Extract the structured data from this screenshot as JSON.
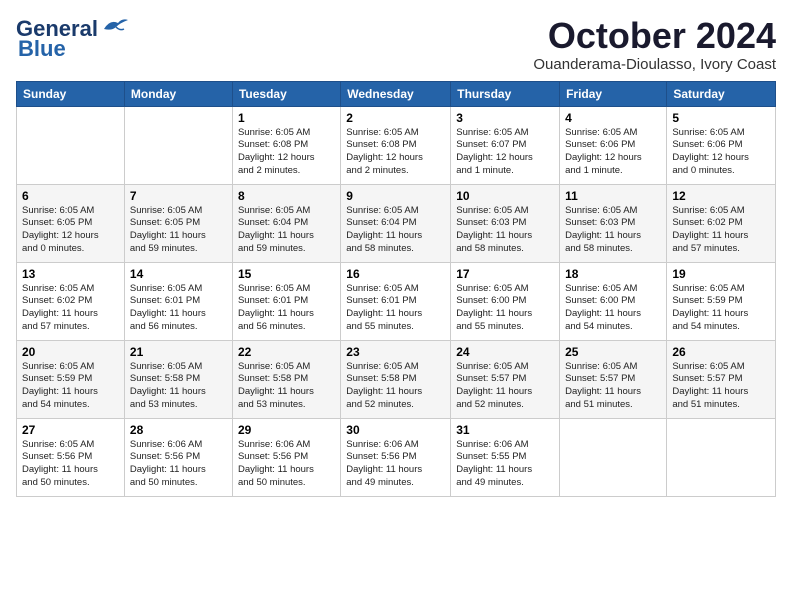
{
  "header": {
    "logo_line1": "General",
    "logo_line2": "Blue",
    "month_title": "October 2024",
    "location": "Ouanderama-Dioulasso, Ivory Coast"
  },
  "days_of_week": [
    "Sunday",
    "Monday",
    "Tuesday",
    "Wednesday",
    "Thursday",
    "Friday",
    "Saturday"
  ],
  "weeks": [
    [
      {
        "day": "",
        "info": ""
      },
      {
        "day": "",
        "info": ""
      },
      {
        "day": "1",
        "info": "Sunrise: 6:05 AM\nSunset: 6:08 PM\nDaylight: 12 hours\nand 2 minutes."
      },
      {
        "day": "2",
        "info": "Sunrise: 6:05 AM\nSunset: 6:08 PM\nDaylight: 12 hours\nand 2 minutes."
      },
      {
        "day": "3",
        "info": "Sunrise: 6:05 AM\nSunset: 6:07 PM\nDaylight: 12 hours\nand 1 minute."
      },
      {
        "day": "4",
        "info": "Sunrise: 6:05 AM\nSunset: 6:06 PM\nDaylight: 12 hours\nand 1 minute."
      },
      {
        "day": "5",
        "info": "Sunrise: 6:05 AM\nSunset: 6:06 PM\nDaylight: 12 hours\nand 0 minutes."
      }
    ],
    [
      {
        "day": "6",
        "info": "Sunrise: 6:05 AM\nSunset: 6:05 PM\nDaylight: 12 hours\nand 0 minutes."
      },
      {
        "day": "7",
        "info": "Sunrise: 6:05 AM\nSunset: 6:05 PM\nDaylight: 11 hours\nand 59 minutes."
      },
      {
        "day": "8",
        "info": "Sunrise: 6:05 AM\nSunset: 6:04 PM\nDaylight: 11 hours\nand 59 minutes."
      },
      {
        "day": "9",
        "info": "Sunrise: 6:05 AM\nSunset: 6:04 PM\nDaylight: 11 hours\nand 58 minutes."
      },
      {
        "day": "10",
        "info": "Sunrise: 6:05 AM\nSunset: 6:03 PM\nDaylight: 11 hours\nand 58 minutes."
      },
      {
        "day": "11",
        "info": "Sunrise: 6:05 AM\nSunset: 6:03 PM\nDaylight: 11 hours\nand 58 minutes."
      },
      {
        "day": "12",
        "info": "Sunrise: 6:05 AM\nSunset: 6:02 PM\nDaylight: 11 hours\nand 57 minutes."
      }
    ],
    [
      {
        "day": "13",
        "info": "Sunrise: 6:05 AM\nSunset: 6:02 PM\nDaylight: 11 hours\nand 57 minutes."
      },
      {
        "day": "14",
        "info": "Sunrise: 6:05 AM\nSunset: 6:01 PM\nDaylight: 11 hours\nand 56 minutes."
      },
      {
        "day": "15",
        "info": "Sunrise: 6:05 AM\nSunset: 6:01 PM\nDaylight: 11 hours\nand 56 minutes."
      },
      {
        "day": "16",
        "info": "Sunrise: 6:05 AM\nSunset: 6:01 PM\nDaylight: 11 hours\nand 55 minutes."
      },
      {
        "day": "17",
        "info": "Sunrise: 6:05 AM\nSunset: 6:00 PM\nDaylight: 11 hours\nand 55 minutes."
      },
      {
        "day": "18",
        "info": "Sunrise: 6:05 AM\nSunset: 6:00 PM\nDaylight: 11 hours\nand 54 minutes."
      },
      {
        "day": "19",
        "info": "Sunrise: 6:05 AM\nSunset: 5:59 PM\nDaylight: 11 hours\nand 54 minutes."
      }
    ],
    [
      {
        "day": "20",
        "info": "Sunrise: 6:05 AM\nSunset: 5:59 PM\nDaylight: 11 hours\nand 54 minutes."
      },
      {
        "day": "21",
        "info": "Sunrise: 6:05 AM\nSunset: 5:58 PM\nDaylight: 11 hours\nand 53 minutes."
      },
      {
        "day": "22",
        "info": "Sunrise: 6:05 AM\nSunset: 5:58 PM\nDaylight: 11 hours\nand 53 minutes."
      },
      {
        "day": "23",
        "info": "Sunrise: 6:05 AM\nSunset: 5:58 PM\nDaylight: 11 hours\nand 52 minutes."
      },
      {
        "day": "24",
        "info": "Sunrise: 6:05 AM\nSunset: 5:57 PM\nDaylight: 11 hours\nand 52 minutes."
      },
      {
        "day": "25",
        "info": "Sunrise: 6:05 AM\nSunset: 5:57 PM\nDaylight: 11 hours\nand 51 minutes."
      },
      {
        "day": "26",
        "info": "Sunrise: 6:05 AM\nSunset: 5:57 PM\nDaylight: 11 hours\nand 51 minutes."
      }
    ],
    [
      {
        "day": "27",
        "info": "Sunrise: 6:05 AM\nSunset: 5:56 PM\nDaylight: 11 hours\nand 50 minutes."
      },
      {
        "day": "28",
        "info": "Sunrise: 6:06 AM\nSunset: 5:56 PM\nDaylight: 11 hours\nand 50 minutes."
      },
      {
        "day": "29",
        "info": "Sunrise: 6:06 AM\nSunset: 5:56 PM\nDaylight: 11 hours\nand 50 minutes."
      },
      {
        "day": "30",
        "info": "Sunrise: 6:06 AM\nSunset: 5:56 PM\nDaylight: 11 hours\nand 49 minutes."
      },
      {
        "day": "31",
        "info": "Sunrise: 6:06 AM\nSunset: 5:55 PM\nDaylight: 11 hours\nand 49 minutes."
      },
      {
        "day": "",
        "info": ""
      },
      {
        "day": "",
        "info": ""
      }
    ]
  ]
}
